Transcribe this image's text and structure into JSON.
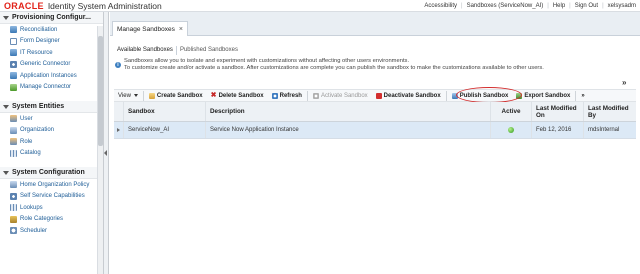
{
  "header": {
    "logo": "ORACLE",
    "title": "Identity System Administration",
    "links": [
      "Accessibility",
      "Sandboxes (ServiceNow_AI)",
      "Help",
      "Sign Out",
      "xelsysadm"
    ]
  },
  "sidebar": {
    "sections": [
      {
        "title": "Provisioning Configur...",
        "items": [
          {
            "label": "Reconciliation",
            "icon": "reconciliation-icon"
          },
          {
            "label": "Form Designer",
            "icon": "form-designer-icon"
          },
          {
            "label": "IT Resource",
            "icon": "it-resource-icon"
          },
          {
            "label": "Generic Connector",
            "icon": "generic-connector-icon"
          },
          {
            "label": "Application Instances",
            "icon": "application-instances-icon"
          },
          {
            "label": "Manage Connector",
            "icon": "manage-connector-icon"
          }
        ]
      },
      {
        "title": "System Entities",
        "items": [
          {
            "label": "User",
            "icon": "user-icon"
          },
          {
            "label": "Organization",
            "icon": "organization-icon"
          },
          {
            "label": "Role",
            "icon": "role-icon"
          },
          {
            "label": "Catalog",
            "icon": "catalog-icon"
          }
        ]
      },
      {
        "title": "System Configuration",
        "items": [
          {
            "label": "Home Organization Policy",
            "icon": "policy-icon"
          },
          {
            "label": "Self Service Capabilities",
            "icon": "self-service-icon"
          },
          {
            "label": "Lookups",
            "icon": "lookups-icon"
          },
          {
            "label": "Role Categories",
            "icon": "role-categories-icon"
          },
          {
            "label": "Scheduler",
            "icon": "scheduler-icon"
          }
        ]
      }
    ]
  },
  "main": {
    "doc_tab": "Manage Sandboxes",
    "doc_tab_close": "×",
    "subtabs": [
      "Available Sandboxes",
      "Published Sandboxes"
    ],
    "info": {
      "line1": "Sandboxes allow you to isolate and experiment with customizations without affecting other users environments.",
      "line2": "To customize create and/or activate a sandbox. After customizations are complete you can publish the sandbox to make the customizations available to other users."
    },
    "toolbar": {
      "view": "View",
      "create": "Create Sandbox",
      "delete": "Delete Sandbox",
      "refresh": "Refresh",
      "activate": "Activate Sandbox",
      "deactivate": "Deactivate Sandbox",
      "publish": "Publish Sandbox",
      "export": "Export Sandbox",
      "more": "»"
    },
    "grid": {
      "columns": [
        "Sandbox",
        "Description",
        "Active",
        "Last Modified On",
        "Last Modified By"
      ],
      "rows": [
        {
          "sandbox": "ServiceNow_AI",
          "description": "Service Now Application Instance",
          "active": "active-green-dot",
          "modified_on": "Feb 12, 2016",
          "modified_by": "mdsInternal"
        }
      ]
    }
  },
  "colors": {
    "oracle_red": "#e2231a",
    "selected_row": "#dce9f6",
    "highlight_ring": "#d32f2f"
  }
}
